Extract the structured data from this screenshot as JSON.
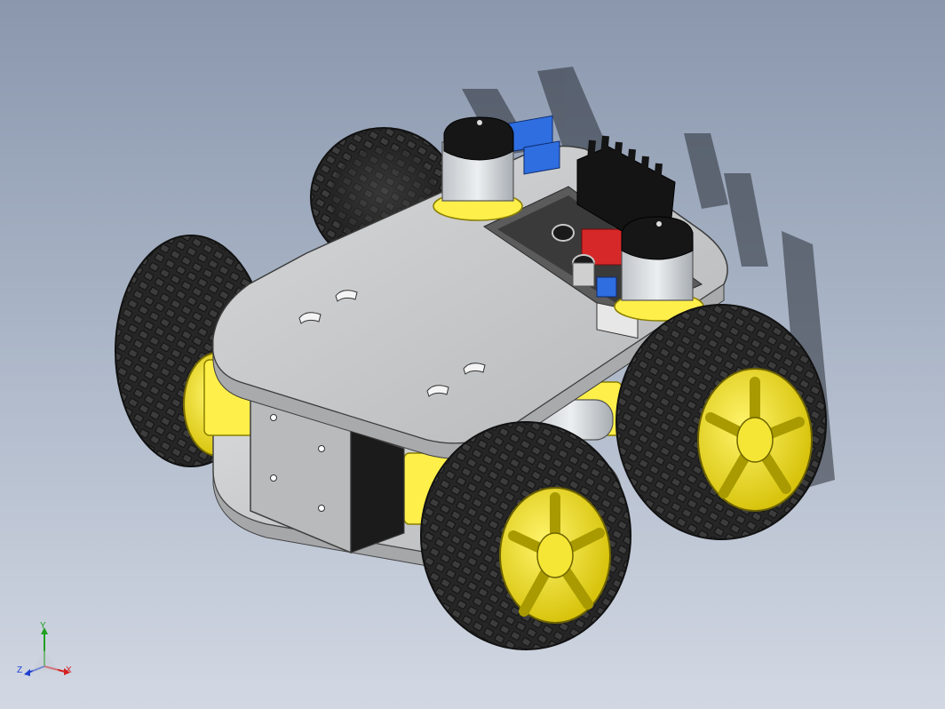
{
  "viewport": {
    "background_top": "#8a97ad",
    "background_bottom": "#d2d8e3"
  },
  "model": {
    "parts": [
      "top-plate",
      "bottom-plate",
      "wheel-front-left",
      "wheel-front-right",
      "wheel-rear-left",
      "wheel-rear-right",
      "motor-front",
      "motor-rear",
      "motor-driver-board",
      "heatsink",
      "side-bracket"
    ],
    "colors": {
      "plate": "#c9cacb",
      "tire": "#2b2b2b",
      "rim": "#f2e31c",
      "motor_housing": "#ffef4a",
      "heatsink": "#1a1a1a",
      "terminal_block": "#2e6ee0",
      "pcb": "#d62828"
    }
  },
  "triad": {
    "x_label": "X",
    "y_label": "Y",
    "z_label": "Z",
    "x_color": "#d42020",
    "y_color": "#20a020",
    "z_color": "#2040d0"
  }
}
